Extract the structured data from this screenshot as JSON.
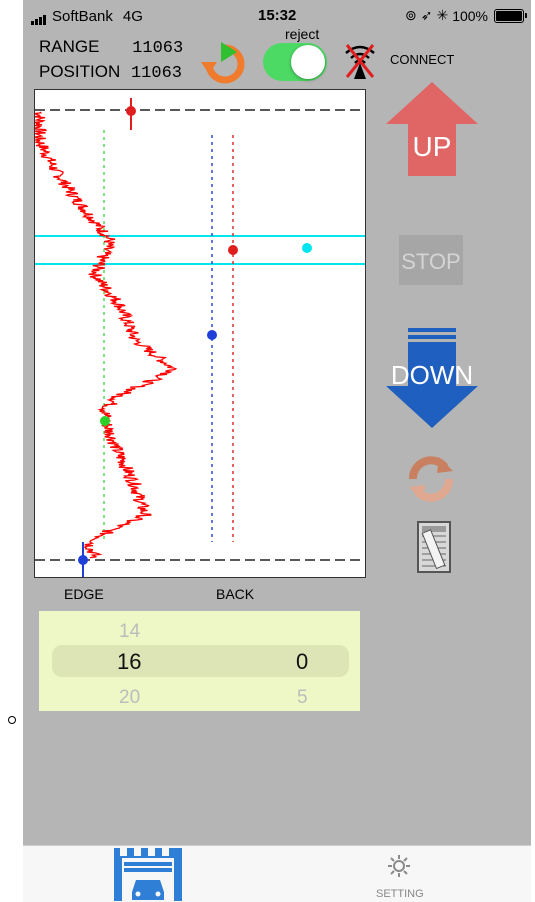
{
  "status_bar": {
    "carrier": "SoftBank",
    "network": "4G",
    "time": "15:32",
    "battery": "100%"
  },
  "readout": {
    "range_label": "RANGE",
    "range_value": "11063",
    "position_label": "POSITION",
    "position_value": "11063"
  },
  "controls": {
    "reject_label": "reject",
    "reject_on": true,
    "connect_label": "CONNECT",
    "up_label": "UP",
    "stop_label": "STOP",
    "down_label": "DOWN"
  },
  "plot": {
    "edge_label": "EDGE",
    "back_label": "BACK"
  },
  "picker": {
    "col1_above": "14",
    "col1_selected": "16",
    "col1_below": "20",
    "col2_selected": "0",
    "col2_below": "5"
  },
  "tab_bar": {
    "setting_label": "SETTING"
  },
  "colors": {
    "app_background": "#b5b5b5",
    "toggle_on": "#4cd964",
    "up_arrow": "#e06666",
    "down_arrow": "#1f5fbf",
    "stop_button": "#a6a6a6",
    "trace": "#ff0000",
    "band": "#00e5ee",
    "picker_bg": "#eef7c6",
    "tab_icon": "#2f7fd6"
  }
}
